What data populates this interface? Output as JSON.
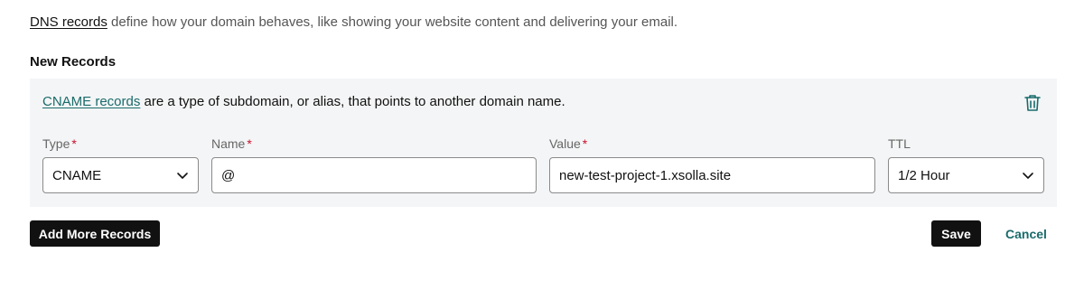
{
  "intro": {
    "link_text": "DNS records",
    "text": " define how your domain behaves, like showing your website content and delivering your email."
  },
  "section_title": "New Records",
  "record": {
    "description_link": "CNAME records",
    "description_text": " are a type of subdomain, or alias, that points to another domain name.",
    "delete_icon": "trash-icon",
    "fields": {
      "type": {
        "label": "Type",
        "required_mark": "*",
        "value": "CNAME"
      },
      "name": {
        "label": "Name",
        "required_mark": "*",
        "value": "@"
      },
      "value": {
        "label": "Value",
        "required_mark": "*",
        "value": "new-test-project-1.xsolla.site"
      },
      "ttl": {
        "label": "TTL",
        "value": "1/2 Hour"
      }
    }
  },
  "actions": {
    "add_more": "Add More Records",
    "save": "Save",
    "cancel": "Cancel"
  },
  "colors": {
    "link_teal": "#1a6b6b",
    "required_red": "#c8102e",
    "panel_bg": "#f4f5f6",
    "button_dark": "#111111"
  }
}
